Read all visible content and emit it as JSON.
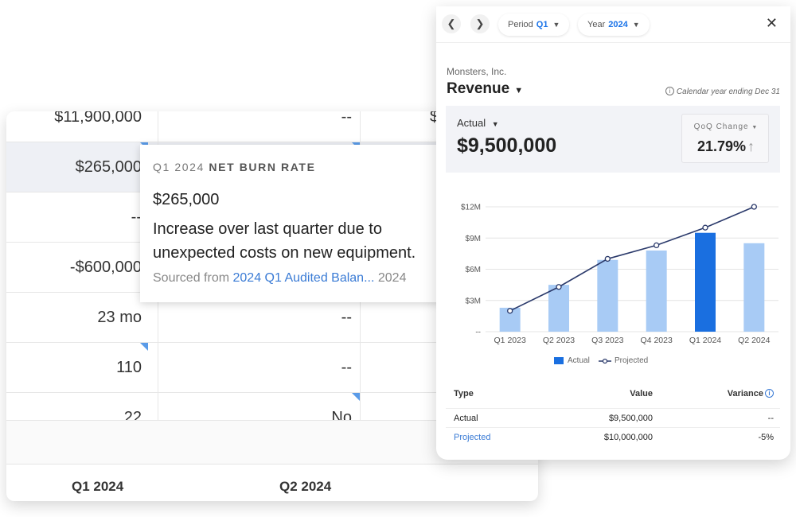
{
  "sheet": {
    "rows": [
      {
        "c1": "$11,900,000",
        "c2": "--",
        "c3": "$"
      },
      {
        "c1": "$265,000",
        "c2": "",
        "c3": ""
      },
      {
        "c1": "--",
        "c2": "",
        "c3": ""
      },
      {
        "c1": "-$600,000",
        "c2": "",
        "c3": ""
      },
      {
        "c1": "23 mo",
        "c2": "--",
        "c3": ""
      },
      {
        "c1": "110",
        "c2": "--",
        "c3": ""
      },
      {
        "c1": "22",
        "c2": "No",
        "c3": ""
      }
    ],
    "col_headers": [
      "Q1 2024",
      "Q2 2024"
    ]
  },
  "tooltip": {
    "title_q": "Q1 2024",
    "title": "NET BURN RATE",
    "value": "$265,000",
    "desc_line1": "Increase over last quarter due to",
    "desc_line2": "unexpected costs on new equipment.",
    "source_prefix": "Sourced from",
    "source_link": "2024 Q1 Audited Balan...",
    "source_suffix": "2024"
  },
  "panel": {
    "period_label": "Period",
    "period_value": "Q1",
    "year_label": "Year",
    "year_value": "2024",
    "company": "Monsters, Inc.",
    "metric": "Revenue",
    "fiscal_note": "Calendar year ending Dec 31",
    "kpi_label": "Actual",
    "kpi_value": "$9,500,000",
    "qoq_label": "QoQ Change",
    "qoq_value": "21.79%",
    "legend_actual": "Actual",
    "legend_projected": "Projected",
    "table": {
      "headers": {
        "type": "Type",
        "value": "Value",
        "variance": "Variance"
      },
      "rows": [
        {
          "type": "Actual",
          "value": "$9,500,000",
          "variance": "--"
        },
        {
          "type": "Projected",
          "value": "$10,000,000",
          "variance": "-5%"
        }
      ]
    },
    "colors": {
      "accent": "#1a73e8",
      "bar_light": "#a8cbf5",
      "bar_active": "#1a6fe0",
      "line": "#2b3a6b"
    }
  },
  "chart_data": {
    "type": "bar",
    "categories": [
      "Q1 2023",
      "Q2 2023",
      "Q3 2023",
      "Q4 2023",
      "Q1 2024",
      "Q2 2024"
    ],
    "series": [
      {
        "name": "Actual",
        "values": [
          2300000,
          4500000,
          6900000,
          7800000,
          9500000,
          8500000
        ]
      },
      {
        "name": "Projected",
        "values": [
          2000000,
          4300000,
          7000000,
          8300000,
          10000000,
          12000000
        ]
      }
    ],
    "y_ticks": [
      "$12M",
      "$9M",
      "$6M",
      "$3M",
      "--"
    ],
    "ylim": [
      0,
      12000000
    ],
    "highlight_index": 4,
    "legend": "bottom-center"
  }
}
